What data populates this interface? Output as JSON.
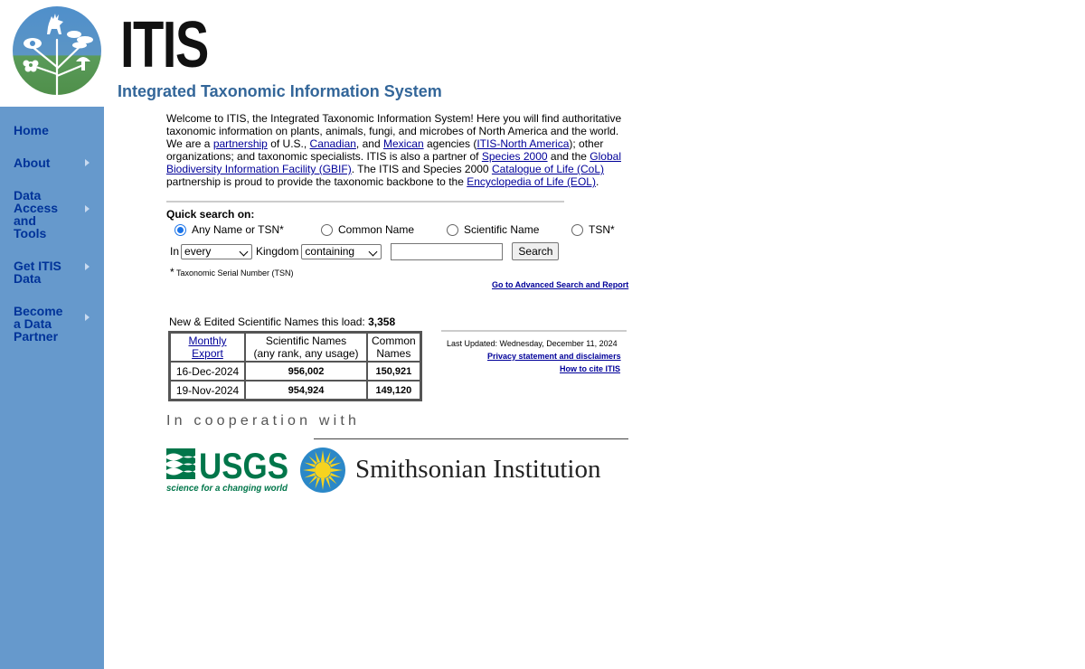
{
  "brand": {
    "wordmark": "ITIS",
    "subtitle": "Integrated Taxonomic Information System"
  },
  "nav": {
    "items": [
      {
        "label": "Home",
        "has_submenu": false
      },
      {
        "label": "About",
        "has_submenu": true
      },
      {
        "label": "Data Access and Tools",
        "has_submenu": true
      },
      {
        "label": "Get ITIS Data",
        "has_submenu": true
      },
      {
        "label": "Become a Data Partner",
        "has_submenu": true
      }
    ]
  },
  "intro": {
    "t1": "Welcome to ITIS, the Integrated Taxonomic Information System! Here you will find authoritative taxonomic information on plants, animals, fungi, and microbes of North America and the world. We are a ",
    "partnership": "partnership",
    "t2": " of U.S., ",
    "canadian": "Canadian",
    "t3": ", and ",
    "mexican": "Mexican",
    "t4": " agencies (",
    "itis_na": "ITIS-North America",
    "t5": "); other organizations; and taxonomic specialists. ITIS is also a partner of ",
    "species2000": "Species 2000",
    "t6": " and the ",
    "gbif": "Global Biodiversity Information Facility (GBIF)",
    "t7": ". The ITIS and Species 2000 ",
    "col": "Catalogue of Life (CoL)",
    "t8": " partnership is proud to provide the taxonomic backbone to the ",
    "eol": "Encyclopedia of Life (EOL)",
    "t9": "."
  },
  "quick_search": {
    "title": "Quick search on:",
    "options": [
      "Any Name or TSN*",
      "Common Name",
      "Scientific Name",
      "TSN*"
    ],
    "selected": "Any Name or TSN*",
    "in_label": "In",
    "kingdom_value": "every",
    "kingdom_label": "Kingdom",
    "match_value": "containing",
    "search_value": "",
    "search_button": "Search",
    "footnote_star": "*",
    "footnote": "Taxonomic Serial Number (TSN)",
    "advanced_link": "Go to Advanced Search and Report"
  },
  "stats": {
    "new_names_label": "New & Edited Scientific Names this load: ",
    "new_names_count": "3,358",
    "header_export": "Monthly Export",
    "header_export_1": "Monthly",
    "header_export_2": "Export",
    "header_sci_1": "Scientific Names",
    "header_sci_2": "(any rank, any usage)",
    "header_common_1": "Common",
    "header_common_2": "Names",
    "rows": [
      {
        "date": "16-Dec-2024",
        "scientific": "956,002",
        "common": "150,921"
      },
      {
        "date": "19-Nov-2024",
        "scientific": "954,924",
        "common": "149,120"
      }
    ]
  },
  "meta": {
    "last_updated": "Last Updated: Wednesday, December 11, 2024",
    "privacy": "Privacy statement and disclaimers",
    "cite": "How to cite ITIS"
  },
  "cooperation": {
    "label": "In cooperation with",
    "usgs_name": "USGS",
    "usgs_tagline": "science for a changing world",
    "smithsonian": "Smithsonian Institution"
  },
  "colors": {
    "sidebar": "#6699cc",
    "nav_text": "#003399",
    "subtitle": "#336699",
    "link": "#000099",
    "usgs_green": "#00764a",
    "smithsonian_blue": "#2b88c8",
    "smithsonian_yellow": "#f6d31f"
  }
}
